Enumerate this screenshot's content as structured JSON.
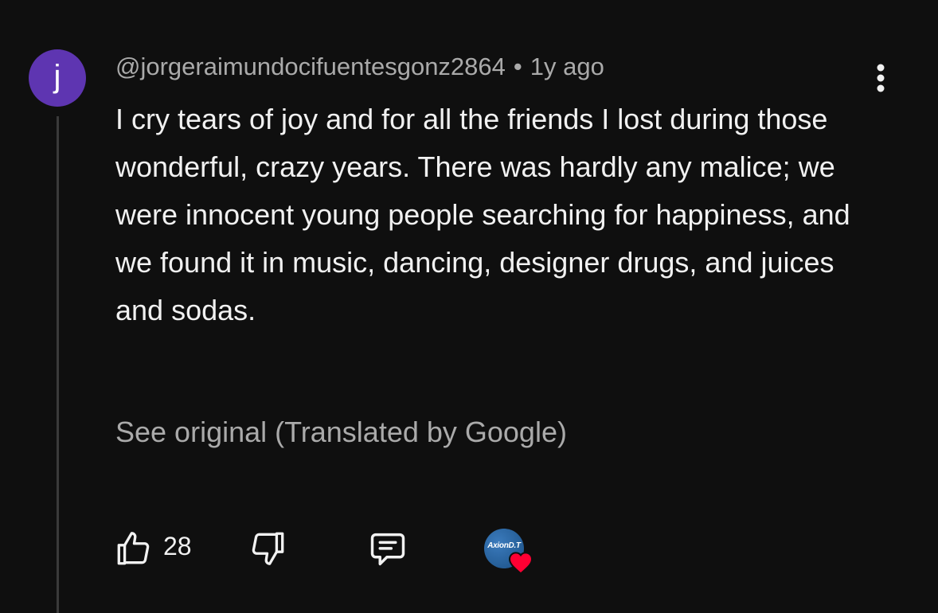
{
  "comment": {
    "avatar_letter": "j",
    "avatar_color": "#5e35b1",
    "author": "@jorgeraimundocifuentesgonz2864",
    "separator": "•",
    "time": "1y ago",
    "text": "I cry tears of joy and for all the friends I lost during those wonderful, crazy years. There was hardly any malice; we were innocent young people searching for happiness, and we found it in music, dancing, designer drugs, and juices and sodas.",
    "see_original": "See original (Translated by Google)",
    "likes": "28",
    "creator_heart": {
      "avatar_label": "AxionD.T",
      "heart_color": "#ff0033"
    }
  },
  "icons": {
    "more": "vertical-ellipsis-icon",
    "like": "thumbs-up-icon",
    "dislike": "thumbs-down-icon",
    "reply": "comment-icon",
    "heart": "heart-icon"
  }
}
